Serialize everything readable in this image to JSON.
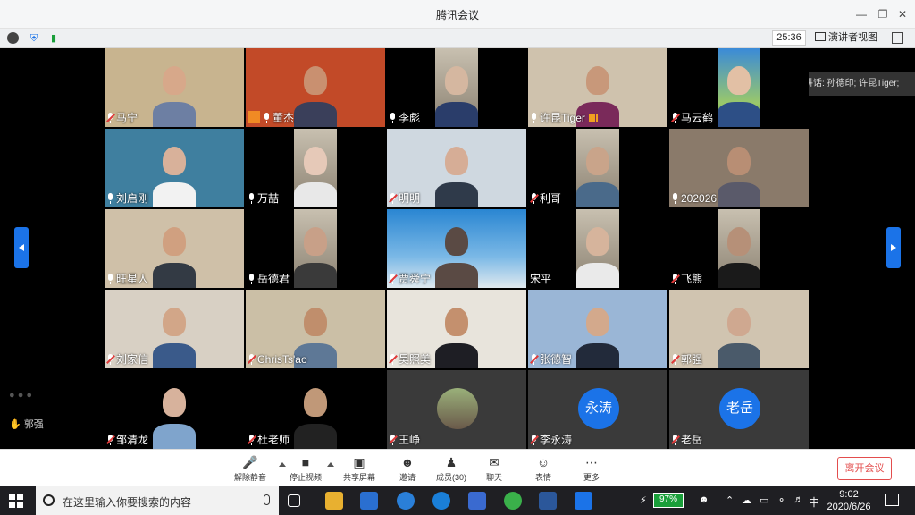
{
  "window": {
    "title": "腾讯会议"
  },
  "status": {
    "timer": "25:36",
    "view_label": "演讲者视图"
  },
  "speaking": "正在讲话: 孙德印; 许昆Tiger;",
  "tiles": [
    {
      "name": "马宁",
      "muted": true,
      "bg": "#c8b48f",
      "face": "#d7a88a",
      "body": "#6d7fa3"
    },
    {
      "name": "董杰",
      "muted": false,
      "bg": "#c24a28",
      "face": "#c99070",
      "body": "#3a3f5a",
      "badge": true
    },
    {
      "name": "李彪",
      "muted": false,
      "bg": "#1a1a1a",
      "face": "#d5b7a0",
      "body": "#2a3d6a",
      "narrow": true
    },
    {
      "name": "许昆Tiger",
      "muted": false,
      "bg": "#cfc2ad",
      "face": "#c8987a",
      "body": "#7a2a5a",
      "signal": true
    },
    {
      "name": "马云鹤",
      "muted": true,
      "bg": "#000000",
      "face": "#e2c0a5",
      "body": "#2d4f86",
      "narrow": true,
      "scenery": true
    },
    {
      "name": "刘启刚",
      "muted": false,
      "bg": "#3f7f9f",
      "face": "#d8b19a",
      "body": "#f2f2f2"
    },
    {
      "name": "万喆",
      "muted": false,
      "bg": "#1a1a1a",
      "face": "#e6c9b8",
      "body": "#e8e8e8",
      "narrow": true
    },
    {
      "name": "明明",
      "muted": true,
      "bg": "#cfd8e0",
      "face": "#d6ad96",
      "body": "#2f3a4a"
    },
    {
      "name": "利哥",
      "muted": true,
      "bg": "#1a1a1a",
      "face": "#c9a48a",
      "body": "#4a6a8a",
      "narrow": true
    },
    {
      "name": "202026",
      "muted": false,
      "bg": "#8a7a6a",
      "face": "#b88e74",
      "body": "#5a5a6a"
    },
    {
      "name": "旺星人",
      "muted": false,
      "bg": "#cfc0a8",
      "face": "#d0a080",
      "body": "#333a44"
    },
    {
      "name": "岳德君",
      "muted": false,
      "bg": "#1a1a1a",
      "face": "#c8a088",
      "body": "#3a3a3a",
      "narrow": true
    },
    {
      "name": "贾舜宁",
      "muted": true,
      "bg": "#2e8fd6",
      "face": "#5a4a44",
      "body": "#5a4a44",
      "sky": true
    },
    {
      "name": "宋平",
      "muted": false,
      "nomic": true,
      "bg": "#1a1a1a",
      "face": "#d6b49c",
      "body": "#eaeaea",
      "narrow": true
    },
    {
      "name": "飞熊",
      "muted": true,
      "bg": "#1a1a1a",
      "face": "#b69078",
      "body": "#1a1a1a",
      "narrow": true
    },
    {
      "name": "刘家信",
      "muted": true,
      "bg": "#d8d0c4",
      "face": "#d2a688",
      "body": "#3a5a8a"
    },
    {
      "name": "ChrisTs'ao",
      "muted": true,
      "bg": "#cbbfa6",
      "face": "#c08e6c",
      "body": "#5e7896"
    },
    {
      "name": "吴照美",
      "muted": true,
      "bg": "#e8e4dc",
      "face": "#c4906e",
      "body": "#1e1e24"
    },
    {
      "name": "张德智",
      "muted": true,
      "bg": "#9ab6d6",
      "face": "#d3a98c",
      "body": "#222a3a"
    },
    {
      "name": "郭强",
      "muted": true,
      "bg": "#d0c4b0",
      "face": "#cfa890",
      "body": "#4a5a6a"
    },
    {
      "name": "邹清龙",
      "muted": true,
      "bg": "#000000",
      "face": "#d7b29c",
      "body": "#7fa4cc",
      "narrow": true
    },
    {
      "name": "杜老师",
      "muted": true,
      "bg": "#000000",
      "face": "#c09878",
      "body": "#222222",
      "narrow": true
    },
    {
      "name": "王峥",
      "muted": true,
      "bg": "#3a3a3a",
      "avatar_photo": true
    },
    {
      "name": "李永涛",
      "muted": true,
      "bg": "#3a3a3a",
      "avatar_text": "永涛"
    },
    {
      "name": "老岳",
      "muted": true,
      "bg": "#3a3a3a",
      "avatar_text": "老岳"
    }
  ],
  "chat": [
    {
      "text": "郭强"
    }
  ],
  "toolbar": {
    "unmute": "解除静音",
    "stop_video": "停止视频",
    "share": "共享屏幕",
    "invite": "邀请",
    "members": "成员(30)",
    "chat": "聊天",
    "emoji": "表情",
    "more": "更多",
    "leave": "离开会议"
  },
  "taskbar": {
    "search_placeholder": "在这里输入你要搜索的内容",
    "battery": "97%",
    "ime": "中",
    "time": "9:02",
    "date": "2020/6/26"
  }
}
